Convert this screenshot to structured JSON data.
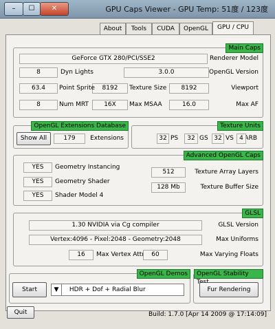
{
  "window": {
    "title": "GPU Caps Viewer - GPU Temp: 51度 / 123度"
  },
  "tabs": [
    "GPU / CPU",
    "OpenGL",
    "CUDA",
    "Tools",
    "About"
  ],
  "main_caps": {
    "title": "Main Caps",
    "renderer_label": "Renderer Model",
    "renderer": "GeForce GTX 280/PCI/SSE2",
    "opengl_version_label": "OpenGL Version",
    "opengl_version": "3.0.0",
    "dyn_lights_label": "Dyn Lights",
    "dyn_lights": "8",
    "viewport_label": "Viewport",
    "viewport": "8192",
    "texture_size_label": "Texture Size",
    "texture_size": "8192",
    "point_sprite_label": "Point Sprite",
    "point_sprite": "63.4",
    "max_af_label": "Max AF",
    "max_af": "16.0",
    "max_msaa_label": "Max MSAA",
    "max_msaa": "16X",
    "num_mrt_label": "Num MRT",
    "num_mrt": "8"
  },
  "ext_db": {
    "title": "OpenGL Extensions Database",
    "extensions_label": "Extensions",
    "extensions": "179",
    "show_all": "Show All"
  },
  "tex_units": {
    "title": "Texture Units",
    "arb_label": "ARB",
    "arb": "4",
    "vs_label": "VS",
    "vs": "32",
    "gs_label": "GS",
    "gs": "32",
    "ps_label": "PS",
    "ps": "32"
  },
  "adv_caps": {
    "title": "Advanced OpenGL Caps",
    "geom_inst_label": "Geometry Instancing",
    "geom_inst": "YES",
    "geom_shader_label": "Geometry Shader",
    "geom_shader": "YES",
    "sm4_label": "Shader Model 4",
    "sm4": "YES",
    "tex_array_label": "Texture Array Layers",
    "tex_array": "512",
    "tex_buffer_label": "Texture Buffer Size",
    "tex_buffer": "128 Mb"
  },
  "glsl": {
    "title": "GLSL",
    "version_label": "GLSL Version",
    "version": "1.30 NVIDIA via Cg compiler",
    "max_uniforms_label": "Max Uniforms",
    "max_uniforms": "Vertex:4096 - Pixel:2048 - Geometry:2048",
    "max_vertex_attribs_label": "Max Vertex Attribs",
    "max_vertex_attribs": "16",
    "max_varying_label": "Max Varying Floats",
    "max_varying": "60"
  },
  "demos": {
    "title": "OpenGL Demos",
    "start": "Start",
    "selected": "HDR + Dof + Radial Blur"
  },
  "stability": {
    "title": "OpenGL Stability Test",
    "fur": "Fur Rendering"
  },
  "footer": {
    "quit": "Quit",
    "build": "Build: 1.7.0 [Apr 14 2009 @ 17:14:09]"
  }
}
